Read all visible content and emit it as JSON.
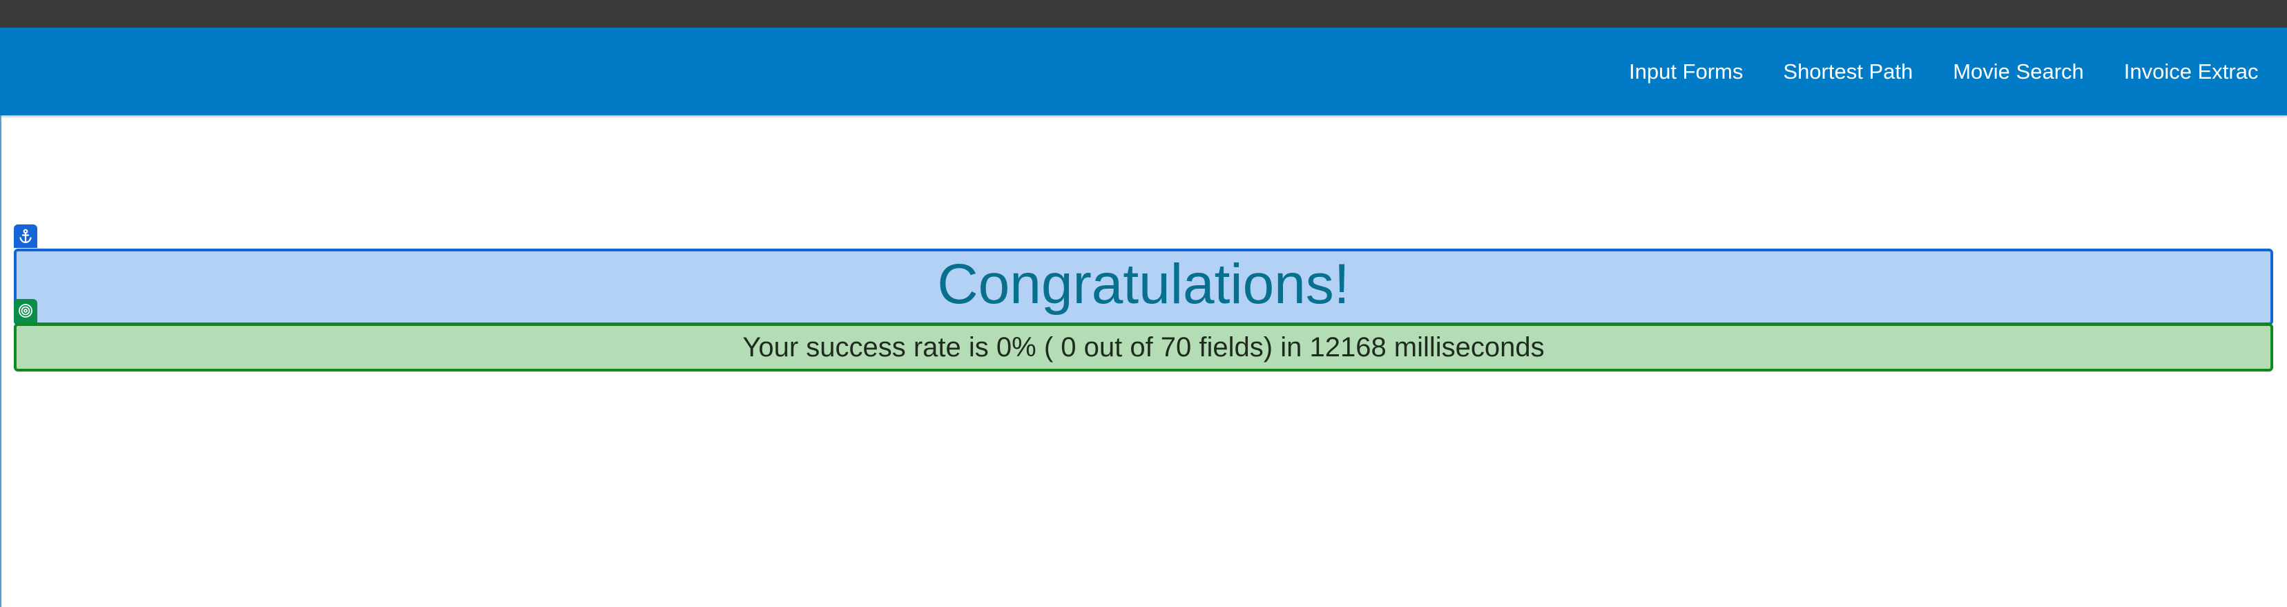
{
  "nav": {
    "links": [
      {
        "label": "Input Forms"
      },
      {
        "label": "Shortest Path"
      },
      {
        "label": "Movie Search"
      },
      {
        "label": "Invoice Extrac"
      }
    ]
  },
  "result": {
    "title": "Congratulations!",
    "message": "Your success rate is 0% ( 0 out of 70 fields) in 12168 milliseconds"
  },
  "icons": {
    "anchor": "anchor-icon",
    "target": "target-icon"
  },
  "colors": {
    "navbar": "#027bc6",
    "title_bg": "#b3d1f5",
    "title_border": "#1565d8",
    "title_text": "#07708e",
    "result_bg": "#b5ddb5",
    "result_border": "#0f8a1f"
  }
}
